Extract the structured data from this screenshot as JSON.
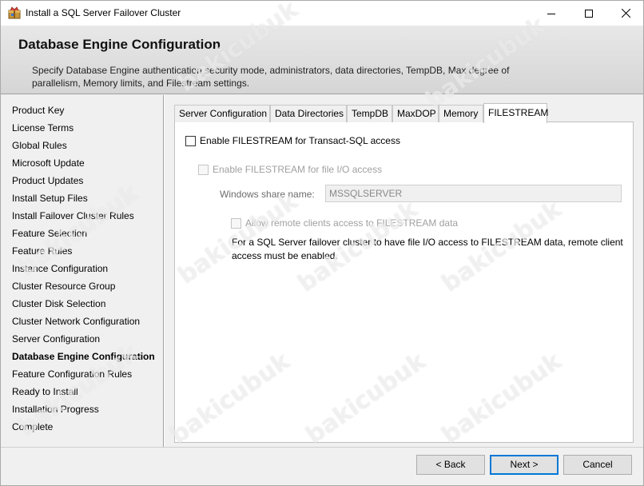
{
  "window": {
    "title": "Install a SQL Server Failover Cluster"
  },
  "header": {
    "title": "Database Engine Configuration",
    "description": "Specify Database Engine authentication security mode, administrators, data directories, TempDB, Max degree of parallelism, Memory limits, and Filestream settings."
  },
  "nav": {
    "items": [
      {
        "label": "Product Key"
      },
      {
        "label": "License Terms"
      },
      {
        "label": "Global Rules"
      },
      {
        "label": "Microsoft Update"
      },
      {
        "label": "Product Updates"
      },
      {
        "label": "Install Setup Files"
      },
      {
        "label": "Install Failover Cluster Rules"
      },
      {
        "label": "Feature Selection"
      },
      {
        "label": "Feature Rules"
      },
      {
        "label": "Instance Configuration"
      },
      {
        "label": "Cluster Resource Group"
      },
      {
        "label": "Cluster Disk Selection"
      },
      {
        "label": "Cluster Network Configuration"
      },
      {
        "label": "Server Configuration"
      },
      {
        "label": "Database Engine Configuration",
        "active": true
      },
      {
        "label": "Feature Configuration Rules"
      },
      {
        "label": "Ready to Install"
      },
      {
        "label": "Installation Progress"
      },
      {
        "label": "Complete"
      }
    ]
  },
  "tabs": [
    {
      "label": "Server Configuration"
    },
    {
      "label": "Data Directories"
    },
    {
      "label": "TempDB"
    },
    {
      "label": "MaxDOP"
    },
    {
      "label": "Memory"
    },
    {
      "label": "FILESTREAM",
      "active": true
    }
  ],
  "filestream": {
    "enable_tsql_label": "Enable FILESTREAM for Transact-SQL access",
    "enable_tsql_checked": false,
    "enable_io_label": "Enable FILESTREAM for file I/O access",
    "enable_io_checked": false,
    "share_name_label": "Windows share name:",
    "share_name_value": "MSSQLSERVER",
    "remote_clients_label": "Allow remote clients access to FILESTREAM data",
    "remote_clients_checked": false,
    "note": "For a SQL Server failover cluster to have file I/O access to FILESTREAM data, remote client access must be enabled."
  },
  "buttons": {
    "back": "< Back",
    "next": "Next >",
    "cancel": "Cancel"
  },
  "watermark": "bakicubuk",
  "colors": {
    "focus_border": "#0078d7",
    "header_bg": "#dcdcdc"
  }
}
